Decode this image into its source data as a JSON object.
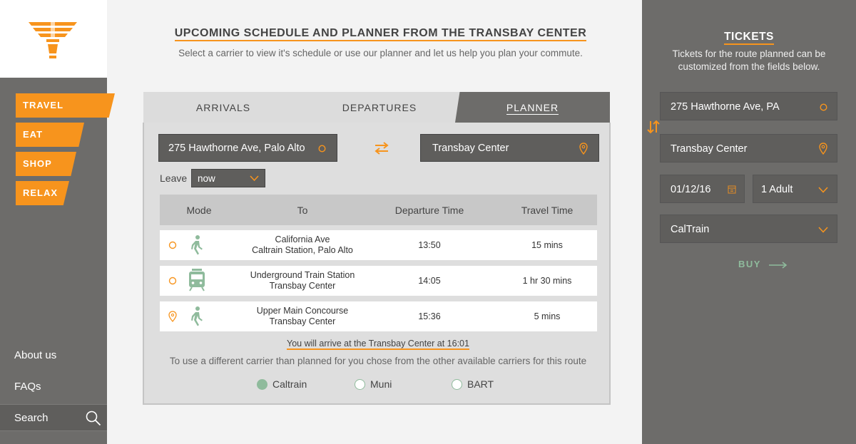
{
  "sidebar": {
    "nav": [
      {
        "label": "TRAVEL"
      },
      {
        "label": "EAT"
      },
      {
        "label": "SHOP"
      },
      {
        "label": "RELAX"
      }
    ],
    "about_label": "About us",
    "faqs_label": "FAQs",
    "search_label": "Search"
  },
  "main": {
    "title": "UPCOMING SCHEDULE AND PLANNER FROM THE TRANSBAY CENTER",
    "subtitle": "Select a carrier to view it's schedule or use our planner and let us help you plan your commute.",
    "tabs": [
      {
        "label": "ARRIVALS"
      },
      {
        "label": "DEPARTURES"
      },
      {
        "label": "PLANNER",
        "active": true
      }
    ],
    "planner": {
      "from_value": "275 Hawthorne Ave, Palo Alto",
      "to_value": "Transbay Center",
      "leave_label": "Leave",
      "leave_value": "now",
      "columns": [
        "Mode",
        "To",
        "Departure Time",
        "Travel Time"
      ],
      "rows": [
        {
          "status_icon": "circle-icon",
          "mode_icon": "walk-icon",
          "to_line1": "California Ave",
          "to_line2": "Caltrain Station, Palo Alto",
          "departure": "13:50",
          "travel": "15 mins"
        },
        {
          "status_icon": "circle-icon",
          "mode_icon": "train-icon",
          "to_line1": "Underground Train Station",
          "to_line2": "Transbay Center",
          "departure": "14:05",
          "travel": "1 hr 30 mins"
        },
        {
          "status_icon": "location-pin-icon",
          "mode_icon": "walk-icon",
          "to_line1": "Upper Main Concourse",
          "to_line2": "Transbay Center",
          "departure": "15:36",
          "travel": "5 mins"
        }
      ],
      "arrival_note": "You will arrive at the Transbay Center at 16:01",
      "carrier_note": "To use a different carrier than planned for you chose from the other available carriers for this route",
      "carriers": [
        {
          "label": "Caltrain",
          "selected": true
        },
        {
          "label": "Muni",
          "selected": false
        },
        {
          "label": "BART",
          "selected": false
        }
      ]
    }
  },
  "tickets": {
    "title": "TICKETS",
    "subtitle": "Tickets for the route planned can be customized from the fields below.",
    "from_value": "275 Hawthorne Ave, PA",
    "to_value": "Transbay Center",
    "date_value": "01/12/16",
    "passengers_value": "1 Adult",
    "carrier_value": "CalTrain",
    "buy_label": "BUY"
  },
  "colors": {
    "accent": "#f7941d",
    "green": "#8fbb9c",
    "sidebar": "#6d6c6a",
    "field": "#5f5e5c"
  }
}
